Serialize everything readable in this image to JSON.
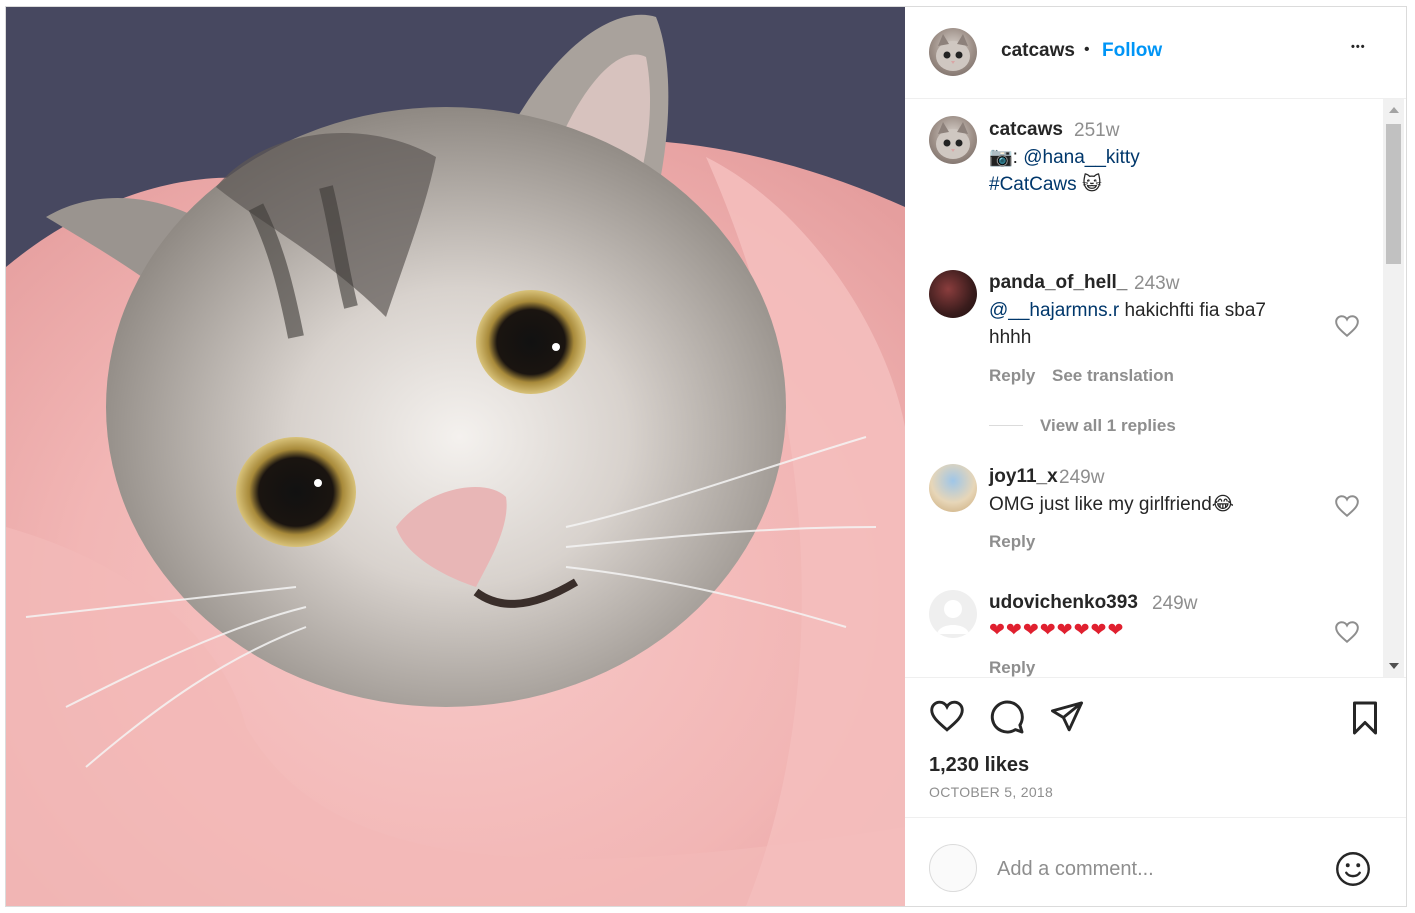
{
  "post": {
    "image_alt": "Grey tabby kitten wrapped in a pink blanket",
    "author": "catcaws",
    "follow_label": "Follow",
    "separator": "•",
    "more_label": "•••",
    "likes": "1,230 likes",
    "date": "OCTOBER 5, 2018"
  },
  "caption": {
    "username": "catcaws",
    "age": "251w",
    "line1_emoji": "📷",
    "line1_sep": ":",
    "mention": "@hana__kitty",
    "hashtag": "#CatCaws",
    "hashtag_emoji": "😺"
  },
  "comments": [
    {
      "username": "panda_of_hell_",
      "age": "243w",
      "mention": "@__hajarmns.r",
      "text": " hakichfti fia sba7",
      "text2": "hhhh",
      "reply": "Reply",
      "translate": "See translation",
      "view_replies": "View all 1 replies"
    },
    {
      "username": "joy11_x",
      "age": "249w",
      "text": "OMG just like my girlfriend😂",
      "reply": "Reply"
    },
    {
      "username": "udovichenko393",
      "age": "249w",
      "text": "❤❤❤❤❤❤❤❤",
      "reply": "Reply"
    }
  ],
  "add_comment": {
    "placeholder": "Add a comment..."
  },
  "icons": {
    "like": "heart-icon",
    "comment": "comment-icon",
    "share": "share-icon",
    "save": "bookmark-icon",
    "emoji": "smiley-icon",
    "more": "more-icon"
  }
}
